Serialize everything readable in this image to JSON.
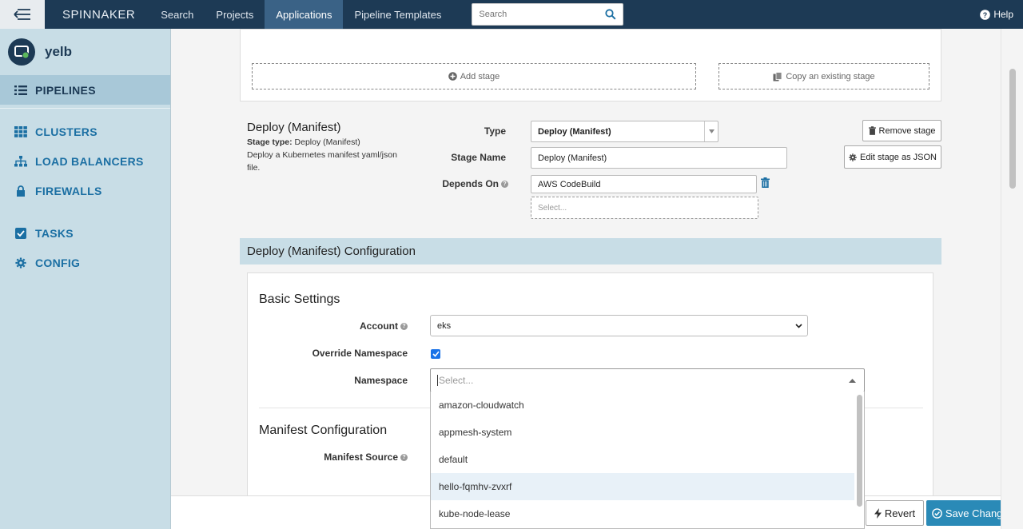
{
  "topnav": {
    "brand": "SPINNAKER",
    "links": [
      "Search",
      "Projects",
      "Applications",
      "Pipeline Templates"
    ],
    "active_link": "Applications",
    "search_placeholder": "Search",
    "help": "Help"
  },
  "sidebar": {
    "app_name": "yelb",
    "items": [
      {
        "label": "PIPELINES",
        "icon": "list-icon",
        "active": true
      },
      {
        "label": "CLUSTERS",
        "icon": "grid-icon"
      },
      {
        "label": "LOAD BALANCERS",
        "icon": "sitemap-icon"
      },
      {
        "label": "FIREWALLS",
        "icon": "lock-icon"
      },
      {
        "label": "TASKS",
        "icon": "check-square-icon"
      },
      {
        "label": "CONFIG",
        "icon": "gear-icon"
      }
    ]
  },
  "stage_controls": {
    "add_stage": "Add stage",
    "copy_stage": "Copy an existing stage"
  },
  "stage": {
    "title": "Deploy (Manifest)",
    "stage_type_label": "Stage type:",
    "stage_type_value": "Deploy (Manifest)",
    "description": "Deploy a Kubernetes manifest yaml/json file.",
    "type_label": "Type",
    "type_value": "Deploy (Manifest)",
    "name_label": "Stage Name",
    "name_value": "Deploy (Manifest)",
    "depends_label": "Depends On",
    "depends_value": "AWS CodeBuild",
    "depends_placeholder": "Select...",
    "remove_button": "Remove stage",
    "edit_json_button": "Edit stage as JSON"
  },
  "config": {
    "section_title": "Deploy (Manifest) Configuration",
    "basic_settings": "Basic Settings",
    "account_label": "Account",
    "account_value": "eks",
    "override_ns_label": "Override Namespace",
    "override_ns_checked": true,
    "namespace_label": "Namespace",
    "namespace_placeholder": "Select...",
    "manifest_config_title": "Manifest Configuration",
    "manifest_source_label": "Manifest Source",
    "namespace_options": [
      "amazon-cloudwatch",
      "appmesh-system",
      "default",
      "hello-fqmhv-zvxrf",
      "kube-node-lease"
    ],
    "highlighted_option": "hello-fqmhv-zvxrf"
  },
  "footer": {
    "revert": "Revert",
    "save": "Save Changes"
  },
  "colors": {
    "nav_bg": "#1d3a55",
    "sidebar_bg": "#c8dde6",
    "accent": "#1b6fa3",
    "save_bg": "#2a8ab7"
  }
}
